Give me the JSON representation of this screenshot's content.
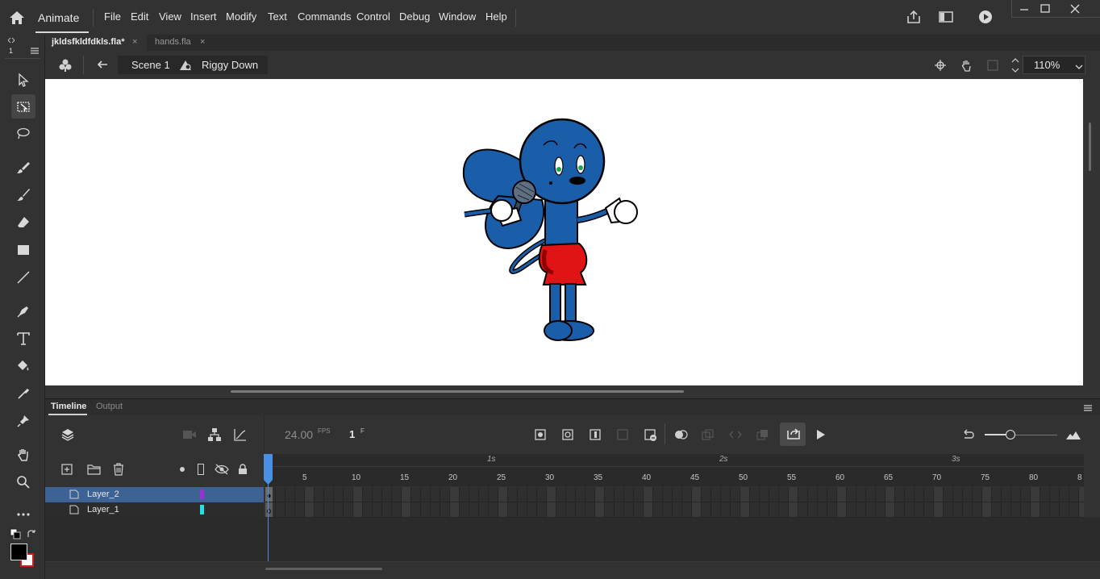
{
  "app": {
    "name": "Animate"
  },
  "menu": [
    "File",
    "Edit",
    "View",
    "Insert",
    "Modify",
    "Text",
    "Commands",
    "Control",
    "Debug",
    "Window",
    "Help"
  ],
  "tabs": [
    {
      "label": "jkldsfkldfdkls.fla*",
      "close": "×"
    },
    {
      "label": "hands.fla",
      "close": "×"
    }
  ],
  "breadcrumb": {
    "scene": "Scene 1",
    "symbol": "Riggy Down"
  },
  "zoom": {
    "value": "110%"
  },
  "panels": {
    "timeline": "Timeline",
    "output": "Output"
  },
  "timeline": {
    "fps_value": "24.00",
    "fps_unit": "FPS",
    "current_frame": "1",
    "frame_unit": "F",
    "ruler_seconds": [
      "1s",
      "2s",
      "3s"
    ],
    "ruler_frames": [
      "5",
      "10",
      "15",
      "20",
      "25",
      "30",
      "35",
      "40",
      "45",
      "50",
      "55",
      "60",
      "65",
      "70",
      "75",
      "80",
      "8"
    ],
    "layers": [
      {
        "name": "Layer_2",
        "color": "#9b30d9",
        "selected": true
      },
      {
        "name": "Layer_1",
        "color": "#22e0e8",
        "selected": false
      }
    ]
  },
  "toolbar": {
    "badge": "1"
  },
  "colors": {
    "stroke": "#000000",
    "fill": "#ffffff",
    "fill_border": "#d01c1c",
    "accent": "#4a90e2"
  },
  "icons": [
    "home-icon",
    "share-icon",
    "window-icon",
    "play-icon",
    "minimize-icon",
    "maximize-icon",
    "close-icon",
    "selection-tool-icon",
    "free-transform-icon",
    "lasso-icon",
    "brush-icon",
    "paint-brush-icon",
    "eraser-icon",
    "rectangle-icon",
    "line-icon",
    "pen-icon",
    "text-icon",
    "paint-bucket-icon",
    "eyedropper-icon",
    "pin-icon",
    "hand-icon",
    "zoom-icon",
    "more-icon"
  ]
}
